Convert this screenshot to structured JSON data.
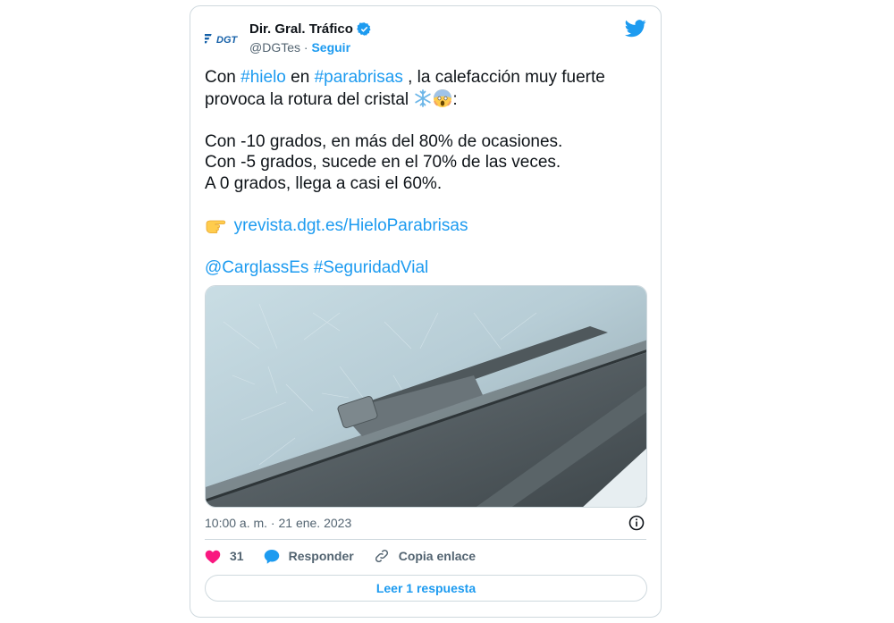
{
  "author": {
    "name": "Dir. Gral. Tráfico",
    "handle": "@DGTes",
    "separator": "·",
    "follow_label": "Seguir",
    "logo_text": "DGT"
  },
  "tweet": {
    "line1_pre": "Con ",
    "tag_hielo": "#hielo",
    "line1_mid": " en ",
    "tag_parabrisas": "#parabrisas",
    "line1_post": " , la calefacción muy fuerte",
    "line2": "provoca la rotura del cristal ",
    "line2_end": ":",
    "stat1": "Con -10 grados, en más del 80% de ocasiones.",
    "stat2": "Con -5 grados, sucede en el 70% de las veces.",
    "stat3": "A 0 grados, llega a casi el 60%.",
    "url": "yrevista.dgt.es/HieloParabrisas",
    "mention": "@CarglassEs",
    "tag_seguridad": "#SeguridadVial",
    "emojis": [
      "snowflake-icon",
      "screaming-face-icon",
      "pointing-hand-icon"
    ]
  },
  "timestamp": "10:00 a. m. · 21 ene. 2023",
  "actions": {
    "likes": "31",
    "reply_label": "Responder",
    "copy_label": "Copia enlace"
  },
  "read_replies_label": "Leer 1 respuesta",
  "colors": {
    "accent": "#1d9bf0",
    "like": "#f91880",
    "text": "#0f1419",
    "muted": "#536471",
    "border": "#cfd9de"
  }
}
